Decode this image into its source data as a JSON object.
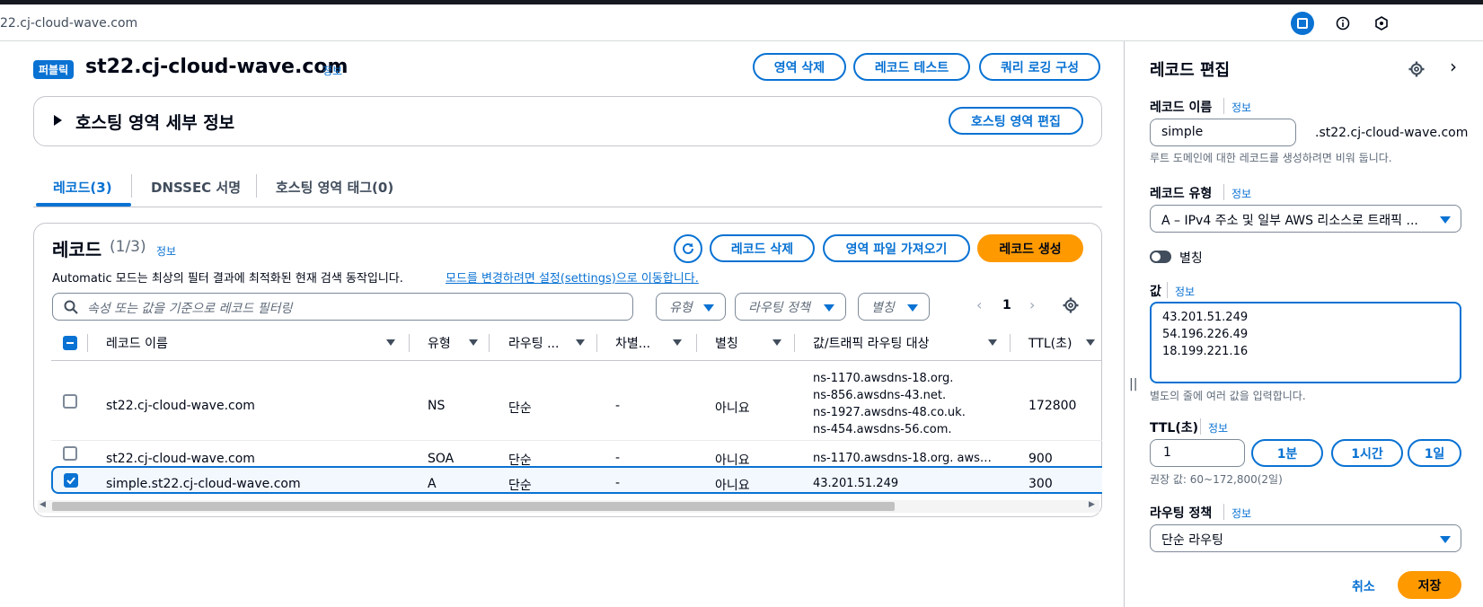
{
  "browser": {
    "url": "22.cj-cloud-wave.com"
  },
  "zone": {
    "badge": "퍼블릭",
    "name": "st22.cj-cloud-wave.com",
    "info": "정보",
    "delete_btn": "영역 삭제",
    "test_btn": "레코드 테스트",
    "query_log_btn": "쿼리 로깅 구성",
    "details_title": "호스팅 영역 세부 정보",
    "edit_zone_btn": "호스팅 영역 편집"
  },
  "tabs": [
    {
      "label": "레코드(3)"
    },
    {
      "label": "DNSSEC 서명"
    },
    {
      "label": "호스팅 영역 태그(0)"
    }
  ],
  "records": {
    "title": "레코드",
    "count": "(1/3)",
    "info": "정보",
    "delete_btn": "레코드 삭제",
    "import_btn": "영역 파일 가져오기",
    "create_btn": "레코드 생성",
    "automatic_text": "Automatic 모드는 최상의 필터 결과에 최적화된 현재 검색 동작입니다.",
    "automatic_link": "모드를 변경하려면 설정(settings)으로 이동합니다.",
    "search_placeholder": "속성 또는 값을 기준으로 레코드 필터링",
    "filter_type": "유형",
    "filter_routing": "라우팅 정책",
    "filter_alias": "별칭",
    "page": "1",
    "columns": [
      "레코드 이름",
      "유형",
      "라우팅 ...",
      "차별...",
      "별칭",
      "값/트래픽 라우팅 대상",
      "TTL(초)"
    ],
    "rows": [
      {
        "name": "st22.cj-cloud-wave.com",
        "type": "NS",
        "routing": "단순",
        "diff": "-",
        "alias": "아니요",
        "values": [
          "ns-1170.awsdns-18.org.",
          "ns-856.awsdns-43.net.",
          "ns-1927.awsdns-48.co.uk.",
          "ns-454.awsdns-56.com."
        ],
        "ttl": "172800"
      },
      {
        "name": "st22.cj-cloud-wave.com",
        "type": "SOA",
        "routing": "단순",
        "diff": "-",
        "alias": "아니요",
        "values": [
          "ns-1170.awsdns-18.org. aws…"
        ],
        "ttl": "900"
      },
      {
        "name": "simple.st22.cj-cloud-wave.com",
        "type": "A",
        "routing": "단순",
        "diff": "-",
        "alias": "아니요",
        "values": [
          "43.201.51.249"
        ],
        "ttl": "300"
      }
    ]
  },
  "editor": {
    "title": "레코드 편집",
    "name_label": "레코드 이름",
    "info": "정보",
    "name_value": "simple",
    "name_suffix": ".st22.cj-cloud-wave.com",
    "name_hint": "루트 도메인에 대한 레코드를 생성하려면 비워 둡니다.",
    "type_label": "레코드 유형",
    "type_value": "A – IPv4 주소 및 일부 AWS 리소스로 트래픽 ...",
    "alias_label": "별칭",
    "value_label": "값",
    "value_text": "43.201.51.249\n54.196.226.49\n18.199.221.16",
    "value_hint": "별도의 줄에 여러 값을 입력합니다.",
    "ttl_label": "TTL(초)",
    "ttl_value": "1",
    "ttl_1m": "1분",
    "ttl_1h": "1시간",
    "ttl_1d": "1일",
    "ttl_hint": "권장 값: 60~172,800(2일)",
    "routing_label": "라우팅 정책",
    "routing_value": "단순 라우팅",
    "cancel": "취소",
    "save": "저장"
  },
  "colors": {
    "accent": "#0972d3",
    "primary": "#ff9900",
    "text": "#000716"
  }
}
